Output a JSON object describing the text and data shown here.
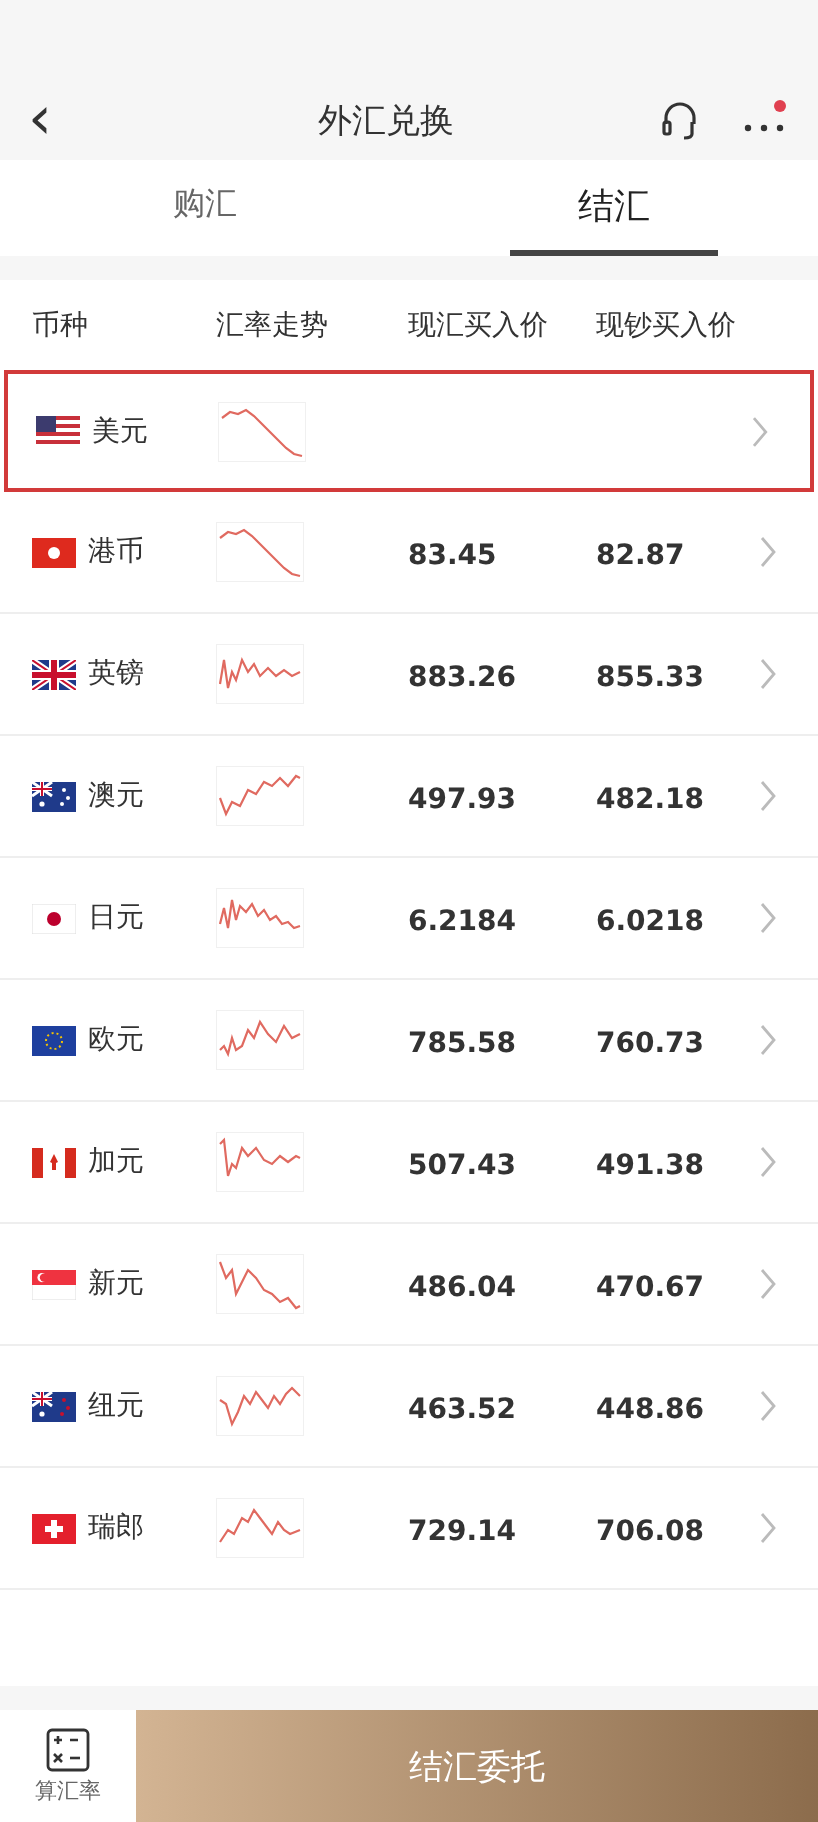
{
  "nav": {
    "title": "外汇兑换",
    "back_icon": "‹",
    "has_notification": true
  },
  "tabs": [
    {
      "label": "购汇",
      "selected": false
    },
    {
      "label": "结汇",
      "selected": true
    }
  ],
  "table": {
    "columns": [
      "币种",
      "汇率走势",
      "现汇买入价",
      "现钞买入价"
    ],
    "rows": [
      {
        "kind": "us",
        "currency": "美元",
        "selected": true
      },
      {
        "kind": "hk",
        "currency": "港币",
        "spot": "83.45",
        "cash": "82.87",
        "selected": false
      },
      {
        "kind": "gb",
        "currency": "英镑",
        "spot": "883.26",
        "cash": "855.33",
        "selected": false
      },
      {
        "kind": "au",
        "currency": "澳元",
        "spot": "497.93",
        "cash": "482.18",
        "selected": false
      },
      {
        "kind": "jp",
        "currency": "日元",
        "spot": "6.2184",
        "cash": "6.0218",
        "selected": false
      },
      {
        "kind": "eu",
        "currency": "欧元",
        "spot": "785.58",
        "cash": "760.73",
        "selected": false
      },
      {
        "kind": "ca",
        "currency": "加元",
        "spot": "507.43",
        "cash": "491.38",
        "selected": false
      },
      {
        "kind": "sg",
        "currency": "新元",
        "spot": "486.04",
        "cash": "470.67",
        "selected": false
      },
      {
        "kind": "nz",
        "currency": "纽元",
        "spot": "463.52",
        "cash": "448.86",
        "selected": false
      },
      {
        "kind": "ch",
        "currency": "瑞郎",
        "spot": "729.14",
        "cash": "706.08",
        "selected": false
      }
    ]
  },
  "bottom_bar": {
    "calculator_label": "算汇率",
    "primary_button": "结汇委托"
  }
}
